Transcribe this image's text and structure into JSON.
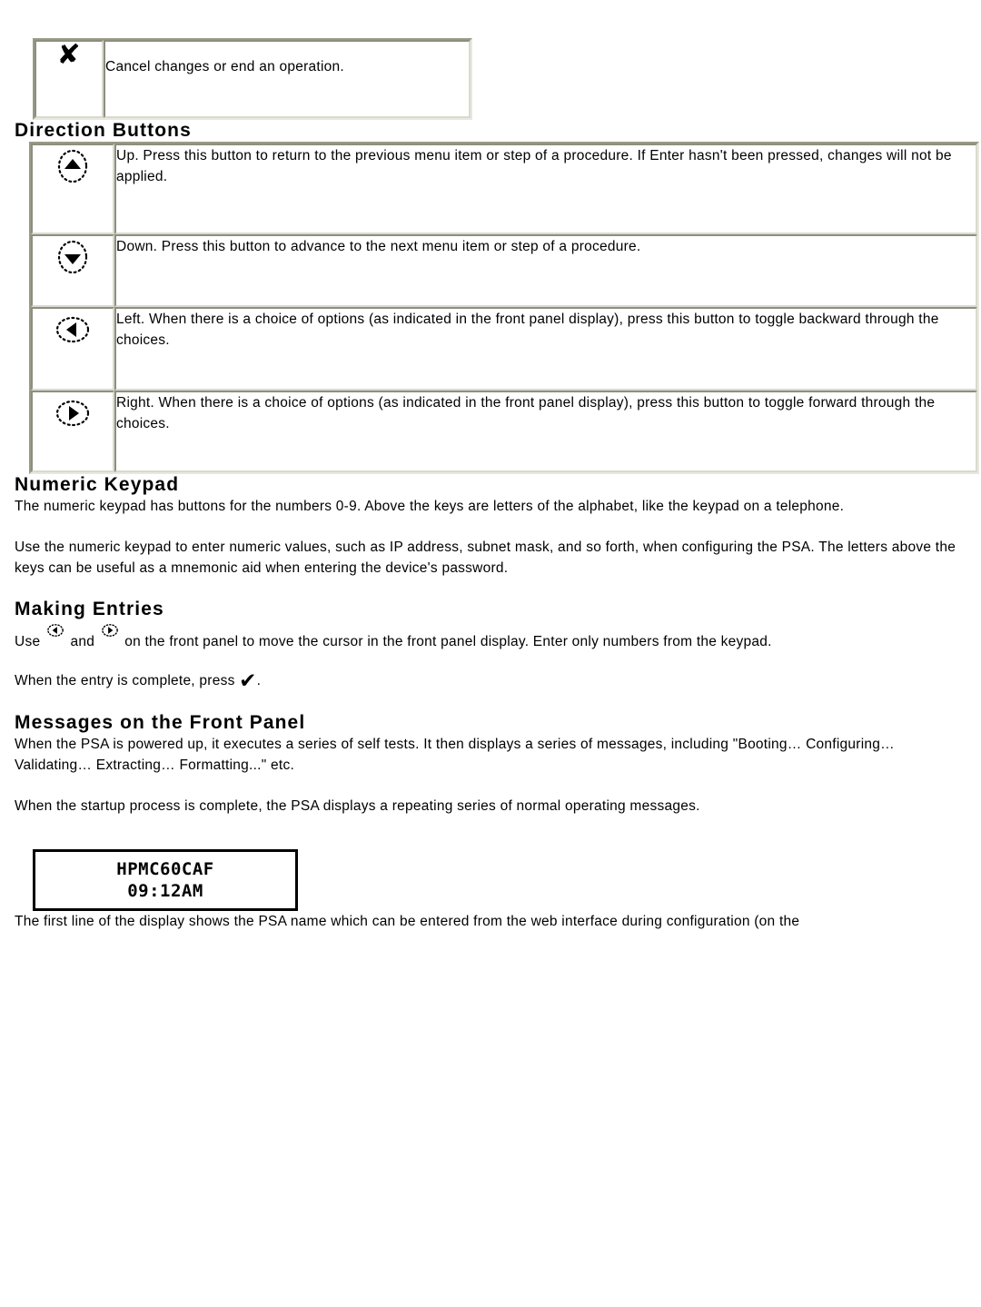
{
  "cancel_table": {
    "icon_name": "x-cancel-icon",
    "icon_glyph": "✘",
    "description": "Cancel changes or end an operation."
  },
  "direction_section": {
    "heading": "Direction Buttons",
    "rows": [
      {
        "icon_name": "up-arrow-button-icon",
        "direction": "up",
        "description": "Up. Press this button to return to the previous menu item or step of a procedure. If Enter hasn't been pressed, changes will not be applied."
      },
      {
        "icon_name": "down-arrow-button-icon",
        "direction": "down",
        "description": "Down. Press this button to advance to the next menu item or step of a procedure."
      },
      {
        "icon_name": "left-arrow-button-icon",
        "direction": "left",
        "description": "Left. When there is a choice of options (as indicated in the front panel display), press this button to toggle backward through the choices."
      },
      {
        "icon_name": "right-arrow-button-icon",
        "direction": "right",
        "description": "Right. When there is a choice of options (as indicated in the front panel display), press this button to toggle forward through the choices."
      }
    ]
  },
  "keypad_section": {
    "heading": "Numeric Keypad",
    "paragraph_1": "The numeric keypad has buttons for the numbers 0-9. Above the keys are letters of the alphabet, like the keypad on a telephone.",
    "paragraph_2": "Use the numeric keypad to enter numeric values, such as IP address, subnet mask, and so forth, when configuring the PSA. The letters above the keys can be useful as a mnemonic aid when entering the device's password."
  },
  "entries_section": {
    "heading": "Making Entries",
    "line1_part1": "Use",
    "line1_and": "and",
    "line1_part2": "on the front panel to move the cursor in the front panel display. Enter only numbers from the keypad.",
    "line2_part1": "When the entry is complete, press",
    "line2_part2": ".",
    "left_icon_name": "left-arrow-inline-icon",
    "right_icon_name": "right-arrow-inline-icon",
    "check_icon_name": "check-enter-icon",
    "check_glyph": "✔"
  },
  "messages_section": {
    "heading": "Messages on the Front Panel",
    "paragraph_1": "When the PSA is powered up, it executes a series of self tests. It then displays a series of messages, including \"Booting… Configuring… Validating… Extracting… Formatting...\" etc.",
    "paragraph_2": "When the startup process is complete, the PSA displays a repeating series of normal operating messages.",
    "lcd": {
      "line_1": "HPMC60CAF",
      "line_2": "09:12AM"
    },
    "paragraph_3": "The first line of the display shows the PSA name which can be entered from the web interface during configuration (on the"
  },
  "colors": {
    "text": "#000000",
    "page_background": "#ffffff",
    "table_border_dark": "#8e8e7e",
    "table_border_light": "#d9d9cf",
    "lcd_border": "#000000"
  }
}
